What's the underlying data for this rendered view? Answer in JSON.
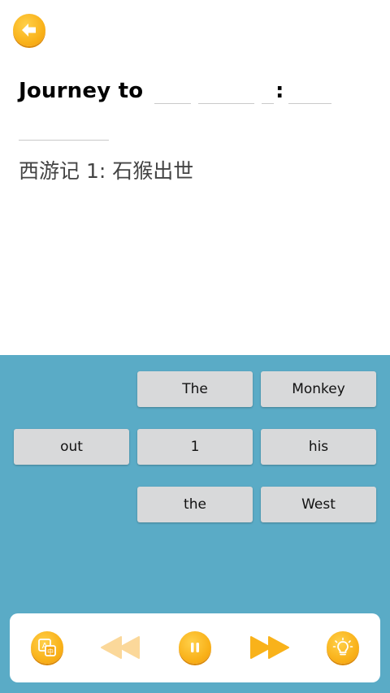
{
  "header": {
    "title_prefix": "Journey to",
    "subtitle": "西游记 1: 石猴出世"
  },
  "word_bank": [
    "The",
    "Monkey",
    "out",
    "1",
    "his",
    "the",
    "West"
  ],
  "colors": {
    "accent": "#f9b21a",
    "panel": "#5aabc6",
    "tile": "#d8d9da"
  },
  "icons": {
    "back": "back-arrow-icon",
    "translate": "translate-icon",
    "rewind": "rewind-icon",
    "pause": "pause-icon",
    "forward": "fast-forward-icon",
    "hint": "lightbulb-icon"
  }
}
